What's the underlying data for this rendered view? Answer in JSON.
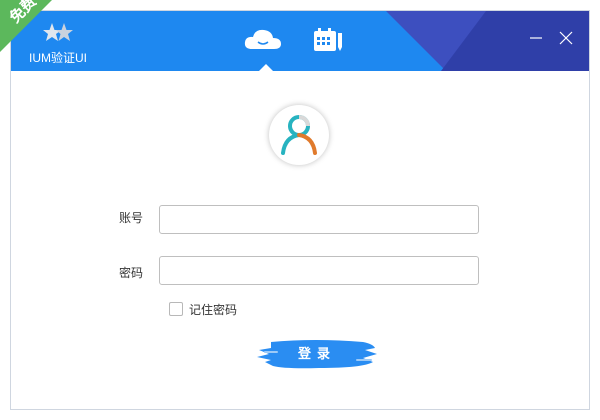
{
  "window": {
    "title": "IUM验证UI",
    "minimize_icon": "minimize-icon",
    "close_icon": "close-icon"
  },
  "badge": {
    "text": "免费"
  },
  "tabs": [
    {
      "icon": "cloud-icon",
      "active": true
    },
    {
      "icon": "calendar-icon",
      "active": false
    }
  ],
  "form": {
    "avatar_icon": "user-avatar-icon",
    "account_label": "账号",
    "account_value": "",
    "password_label": "密码",
    "password_value": "",
    "remember_label": "记住密码",
    "remember_checked": false,
    "login_label": "登录"
  },
  "colors": {
    "header_blue": "#1e88f0",
    "header_dark": "#3d4fbf",
    "badge_green": "#5cb85c"
  }
}
